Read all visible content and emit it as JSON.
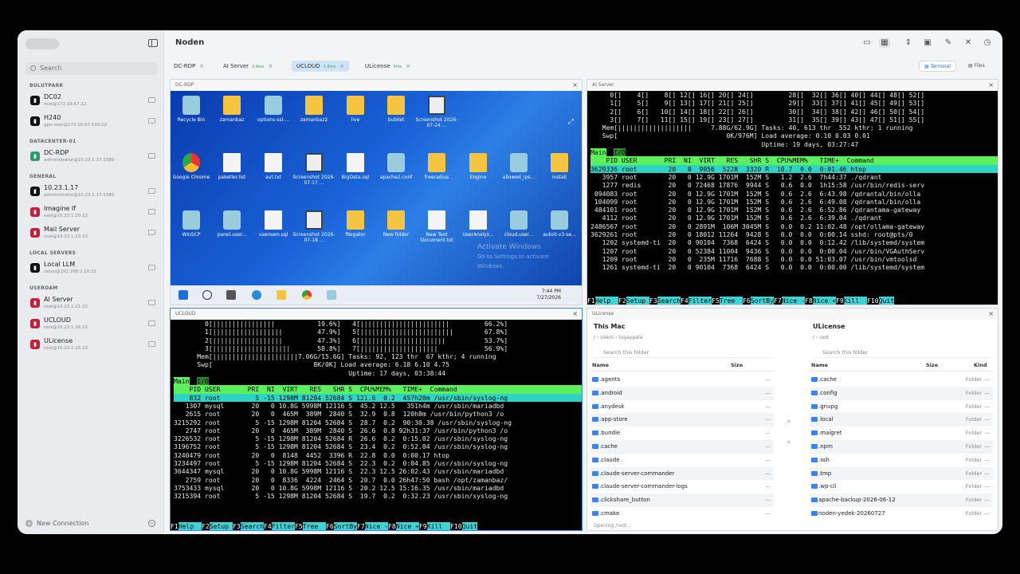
{
  "app_title": "Noden",
  "search_placeholder": "Search",
  "sidebar": {
    "groups": [
      {
        "label": "BULUTPARK",
        "hosts": [
          {
            "name": "DC02",
            "sub": "root@172.16.67.22",
            "color": "#111"
          },
          {
            "name": "H240",
            "sub": "gpu-user@172.16.67.100:22",
            "color": "#111"
          }
        ]
      },
      {
        "label": "DATACENTER-01",
        "hosts": [
          {
            "name": "DC-RDP",
            "sub": "administrator@10.23.1.17:3389",
            "color": "#2e9a6a"
          }
        ]
      },
      {
        "label": "GENERAL",
        "hosts": [
          {
            "name": "10.23.1.17",
            "sub": "administrator@10.23.1.17:3389",
            "color": "#111"
          },
          {
            "name": "Imagine If",
            "sub": "root@10.23.1.20:22",
            "color": "#c0213a"
          },
          {
            "name": "Mail Server",
            "sub": "root@10.23.1.23:22",
            "color": "#c0213a"
          }
        ]
      },
      {
        "label": "LOCAL SERVERS",
        "hosts": [
          {
            "name": "Local LLM",
            "sub": "cetus@192.168.2.20:22",
            "color": "#111"
          }
        ]
      },
      {
        "label": "USEROAM",
        "hosts": [
          {
            "name": "AI Server",
            "sub": "root@10.23.1.21:22",
            "color": "#c0213a"
          },
          {
            "name": "UCLOUD",
            "sub": "root@10.23.1.16:22",
            "color": "#c0213a"
          },
          {
            "name": "ULicense",
            "sub": "root@10.23.1.15:22",
            "color": "#c0213a"
          }
        ]
      }
    ],
    "new_connection": "New Connection"
  },
  "tabs": [
    {
      "label": "DC-RDP",
      "badge": ""
    },
    {
      "label": "AI Server",
      "badge": "3.4ms"
    },
    {
      "label": "UCLOUD",
      "badge": "1.6ms"
    },
    {
      "label": "ULicense",
      "badge": "9ms"
    }
  ],
  "modes": {
    "terminal": "Terminal",
    "files": "Files"
  },
  "panes": {
    "rdp": {
      "title": "DC-RDP",
      "icons": [
        {
          "label": "Recycle Bin",
          "kind": "app"
        },
        {
          "label": "zamanbaz",
          "kind": "folder"
        },
        {
          "label": "options-ssl-...",
          "kind": "app"
        },
        {
          "label": "zamanbaz2",
          "kind": "folder"
        },
        {
          "label": "live",
          "kind": "folder"
        },
        {
          "label": "bubilet",
          "kind": "folder"
        },
        {
          "label": "Screenshot 2026-07-24 ...",
          "kind": "shot"
        },
        {
          "label": "Google Chrome",
          "kind": "chrome"
        },
        {
          "label": "paketler.list",
          "kind": "file"
        },
        {
          "label": "aut.txt",
          "kind": "file"
        },
        {
          "label": "Screenshot 2026-07-17 ...",
          "kind": "shot"
        },
        {
          "label": "BigData.sql",
          "kind": "file"
        },
        {
          "label": "apache2.conf",
          "kind": "app"
        },
        {
          "label": "freeradius",
          "kind": "folder"
        },
        {
          "label": "Engine",
          "kind": "folder"
        },
        {
          "label": "allowed_ips...",
          "kind": "app"
        },
        {
          "label": "install",
          "kind": "folder"
        },
        {
          "label": "WinSCP",
          "kind": "app"
        },
        {
          "label": "panel.user...",
          "kind": "app"
        },
        {
          "label": "useroam.sql",
          "kind": "file"
        },
        {
          "label": "Screenshot 2026-07-18 ...",
          "kind": "shot"
        },
        {
          "label": "filegator",
          "kind": "folder"
        },
        {
          "label": "New folder",
          "kind": "folder"
        },
        {
          "label": "New Text Document.txt",
          "kind": "file"
        },
        {
          "label": "UserAnalyz...",
          "kind": "file"
        },
        {
          "label": "cloud.user...",
          "kind": "app"
        },
        {
          "label": "autoit-v3-se...",
          "kind": "app"
        }
      ],
      "watermark_1": "Activate Windows",
      "watermark_2": "Go to Settings to activate",
      "watermark_3": "Windows.",
      "time": "7:44 PM",
      "date": "7/27/2026"
    },
    "ai": {
      "title": "AI Server",
      "lines": [
        "     0[]    4[]    8[] 12[] 16[] 20[] 24[]         28[]  32[] 36[] 40[] 44[] 48[] 52[]",
        "     1[]    5[]    9[] 13[] 17[] 21[] 25[]         29[]  33[] 37[] 41[] 45[] 49[] 53[]",
        "     2[]    6[]   10[] 14[] 18[] 22[] 26[]         30[]  34[] 38[] 42[] 46[] 50[] 54[]",
        "     3[]    7[]   11[] 15[] 19[] 23[] 27[]         31[]  35[] 39[] 43[] 47[] 51[] 55[]",
        "   Mem[|||||||||||||||||||     7.88G/62.9G] Tasks: 40, 613 thr  552 kthr; 1 running",
        "   Swp[                            0K/976M] Load average: 0.10 0.03 0.01",
        "                                            Uptime: 19 days, 03:27:47"
      ],
      "tab_main": "Main",
      "tab_io": "I/O",
      "header": "    PID USER       PRI  NI  VIRT   RES   SHR S  CPU%MEM%   TIME+  Command",
      "sel": "3629336 root        20   0  9056  5228  3320 R  10.7  0.0  0:01.46 htop",
      "rows": [
        "   3957 root        20   0 12.9G 1701M  152M S   1.2  2.6  7h44:37 ./qdrant",
        "   1277 redis       20   0 72468 17876  9944 S   0.6  0.0  1h15:58 /usr/bin/redis-serv",
        " 094083 root        20   0 12.9G 1701M  152M S   0.6  2.6  6:43.98 /qdrantal/bin/olla",
        " 104099 root        20   0 12.9G 1701M  152M S   0.6  2.6  6:49.08 /qdrantal/bin/olla",
        " 484101 root        20   0 12.9G 1701M  152M S   0.6  2.6  6:52.86 /qdrantama-gateway",
        "   4112 root        20   0 12.9G 1701M  152M S   0.6  2.6  6:39.04 ./qdrant",
        "2486567 root        20   0 2891M  106M 3045M S   0.0  0.2 11:02.48 /opt/ollama-gateway",
        "3629261 root        20   0 18012 11264  9428 S   0.0  0.0  0:00.14 sshd: root@pts/0",
        "   1202 systemd-ti  20   0 90104  7368  6424 S   0.0  0.0  0:12.42 /lib/systemd/system",
        "   1207 root        20   0 52384 11004  9436 S   0.0  0.0  0:00.04 /usr/bin/VGAuthServ",
        "   1209 root        20   0  235M 11716  7688 S   0.0  0.0 51:03.07 /usr/bin/vmtoolsd",
        "   1261 systemd-ti  20   0 90104  7368  6424 S   0.0  0.0  0:00.00 /lib/systemd/system"
      ]
    },
    "ucloud": {
      "title": "UCLOUD",
      "lines": [
        "        0[||||||||||||||||           19.6%]   4[|||||||||||||||||||||||         66.2%]",
        "        1[||||||||||||||||||         47.9%]   5[||||||||||||||||||||||||        67.8%]",
        "        2[||||||||||||||||||         47.3%]   6[||||||||||||||||||||||          53.7%]",
        "        3[||||||||||||||||||||       58.8%]   7[||||||||||||||||||||            56.9%]",
        "      Mem[||||||||||||||||||||||7.06G/15.6G] Tasks: 92, 123 thr  67 kthr; 4 running",
        "      Swp[                          8K/0K] Load average: 6.18 6.10 4.75",
        "                                             Uptime: 17 days, 03:38:44"
      ],
      "tab_main": "Main",
      "tab_io": "I/O",
      "header": "    PID USER       PRI  NI  VIRT   RES   SHR S  CPU%MEM%   TIME+  Command",
      "sel": "    832 root         5 -15 1298M 81204 52684 S 121.6  0.2  457h20m /usr/sbin/syslog-ng",
      "rows": [
        "   1307 mysql       20   0 10.8G 5998M 12116 S  45.2 12.5   351h4m /usr/sbin/mariadbd",
        "   2615 root        20   0  465M  389M  2840 S  32.9  0.8  120h8m /usr/bin/python3 /o",
        "3215292 root         5 -15 1298M 81204 52684 S  28.7  0.2  90:30.38 /usr/sbin/syslog-ng",
        "   2747 root        20   0  465M  389M  2840 S  26.6  0.8 92h31:37 /usr/bin/python3 /o",
        "3226532 root         5 -15 1298M 81204 52684 R  26.6  0.2  0:15.02 /usr/sbin/syslog-ng",
        "3196752 root         5 -15 1298M 81204 52684 S  23.4  0.2  0:52.04 /usr/sbin/syslog-ng",
        "3240479 root        20   0  8148  4452  3396 R  22.8  0.0  0:00.17 htop",
        "3234497 root         5 -15 1298M 81204 52684 S  22.3  0.2  0:04.85 /usr/sbin/syslog-ng",
        "3644347 mysql       20   0 10.8G 5998M 12116 S  22.3 12.5 26:02.43 /usr/sbin/mariadbd",
        "   2759 root        20   0  8336  4224  2464 S  20.7  0.0 26h47:50 bash /opt/zamanbaz/",
        "3753433 mysql       20   0 10.8G 5998M 12116 S  20.2 12.5 15:16.35 /usr/sbin/mariadbd",
        "3215394 root         5 -15 1298M 81204 52684 S  19.7  0.2  0:32.23 /usr/sbin/syslog-ng"
      ]
    },
    "fkeys": [
      {
        "k": "F1",
        "v": "Help  "
      },
      {
        "k": "F2",
        "v": "Setup "
      },
      {
        "k": "F3",
        "v": "Search"
      },
      {
        "k": "F4",
        "v": "Filter"
      },
      {
        "k": "F5",
        "v": "Tree  "
      },
      {
        "k": "F6",
        "v": "SortBy"
      },
      {
        "k": "F7",
        "v": "Nice -"
      },
      {
        "k": "F8",
        "v": "Nice +"
      },
      {
        "k": "F9",
        "v": "Kill  "
      },
      {
        "k": "F10",
        "v": "Quit"
      }
    ],
    "files": {
      "title": "ULicense",
      "left": {
        "title": "This Mac",
        "path": "/ › Users › tugaypala",
        "search": "Search this folder",
        "col_name": "Name",
        "col_size": "Size",
        "items": [
          ".agents",
          ".android",
          ".anydesk",
          ".app-store",
          ".bundle",
          ".cache",
          ".claude",
          ".claude-server-commander",
          ".claude-server-commander-logs",
          ".clickshare_button",
          ".cmake"
        ]
      },
      "right": {
        "title": "ULicense",
        "path": "/ › root",
        "search": "Search this folder",
        "col_name": "Name",
        "col_size": "Size",
        "col_kind": "Kind",
        "kind": "Folder",
        "items": [
          ".cache",
          ".config",
          ".gnupg",
          ".local",
          ".maigret",
          ".npm",
          ".ssh",
          ".tmp",
          ".wp-cli",
          "apache-backup-2026-06-12",
          "noden-yedek-20260727"
        ]
      },
      "status": "Opening /root..."
    }
  }
}
